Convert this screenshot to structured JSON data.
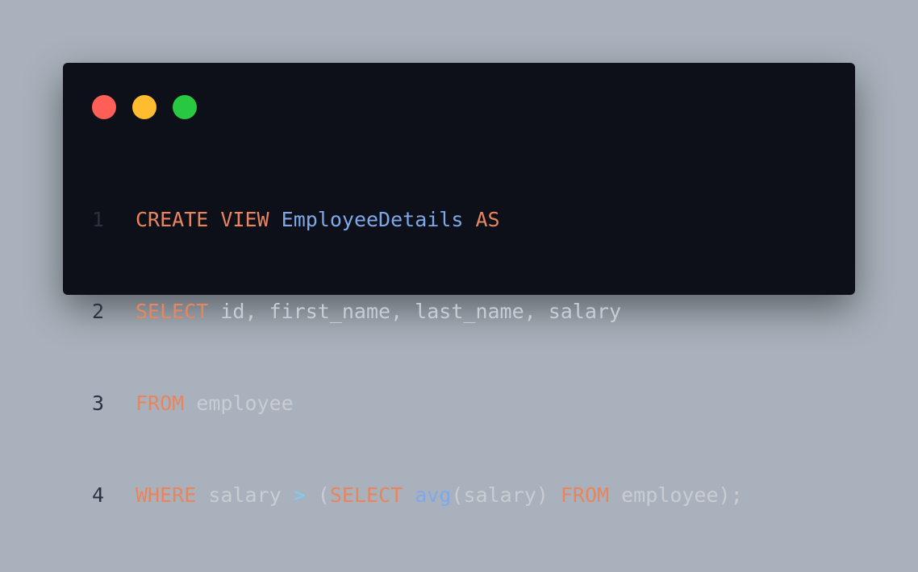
{
  "window": {
    "controls": [
      {
        "name": "close",
        "color": "#ff5f57"
      },
      {
        "name": "minimize",
        "color": "#febc2e"
      },
      {
        "name": "maximize",
        "color": "#28c840"
      }
    ]
  },
  "colors": {
    "background": "#a9b2bc",
    "editor_background": "#0d1018",
    "keyword": "#e8855e",
    "function": "#7fa8ea",
    "operator": "#7dcdf0",
    "plain": "#c9ccd3",
    "line_number": "#2b313f"
  },
  "code": {
    "lines": [
      {
        "number": "1",
        "tokens": [
          {
            "text": "CREATE VIEW",
            "kind": "kw"
          },
          {
            "text": " ",
            "kind": "txt"
          },
          {
            "text": "EmployeeDetails",
            "kind": "fn"
          },
          {
            "text": " ",
            "kind": "txt"
          },
          {
            "text": "AS",
            "kind": "kw"
          }
        ]
      },
      {
        "number": "2",
        "tokens": [
          {
            "text": "SELECT",
            "kind": "kw"
          },
          {
            "text": " id, first_name, last_name, salary",
            "kind": "txt"
          }
        ]
      },
      {
        "number": "3",
        "tokens": [
          {
            "text": "FROM",
            "kind": "kw"
          },
          {
            "text": " employee",
            "kind": "txt"
          }
        ]
      },
      {
        "number": "4",
        "tokens": [
          {
            "text": "WHERE",
            "kind": "kw"
          },
          {
            "text": " salary ",
            "kind": "txt"
          },
          {
            "text": ">",
            "kind": "op"
          },
          {
            "text": " (",
            "kind": "txt"
          },
          {
            "text": "SELECT",
            "kind": "kw"
          },
          {
            "text": " ",
            "kind": "txt"
          },
          {
            "text": "avg",
            "kind": "fn"
          },
          {
            "text": "(salary) ",
            "kind": "txt"
          },
          {
            "text": "FROM",
            "kind": "kw"
          },
          {
            "text": " employee);",
            "kind": "txt"
          }
        ]
      }
    ]
  }
}
